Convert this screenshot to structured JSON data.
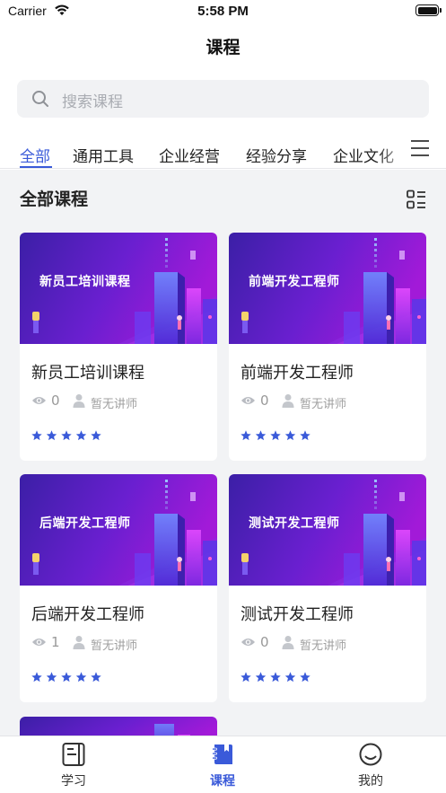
{
  "status_bar": {
    "carrier": "Carrier",
    "time": "5:58 PM"
  },
  "nav": {
    "title": "课程"
  },
  "search": {
    "placeholder": "搜索课程",
    "icon": "search-icon"
  },
  "tabs": [
    {
      "label": "全部",
      "active": true
    },
    {
      "label": "通用工具",
      "active": false
    },
    {
      "label": "企业经营",
      "active": false
    },
    {
      "label": "经验分享",
      "active": false
    },
    {
      "label": "企业文化",
      "active": false
    }
  ],
  "section": {
    "title": "全部课程"
  },
  "courses": [
    {
      "banner_text": "新员工培训课程",
      "title": "新员工培训课程",
      "views": "0",
      "teacher": "暂无讲师",
      "rating": 5
    },
    {
      "banner_text": "前端开发工程师",
      "title": "前端开发工程师",
      "views": "0",
      "teacher": "暂无讲师",
      "rating": 5
    },
    {
      "banner_text": "后端开发工程师",
      "title": "后端开发工程师",
      "views": "1",
      "teacher": "暂无讲师",
      "rating": 5
    },
    {
      "banner_text": "测试开发工程师",
      "title": "测试开发工程师",
      "views": "0",
      "teacher": "暂无讲师",
      "rating": 5
    }
  ],
  "tabbar": [
    {
      "label": "学习",
      "icon": "study-icon",
      "active": false
    },
    {
      "label": "课程",
      "icon": "course-book-icon",
      "active": true
    },
    {
      "label": "我的",
      "icon": "profile-face-icon",
      "active": false
    }
  ],
  "colors": {
    "accent": "#3a5ad9",
    "banner_from": "#3b1fa6",
    "banner_to": "#a21ad8",
    "star": "#3a5ad9"
  }
}
